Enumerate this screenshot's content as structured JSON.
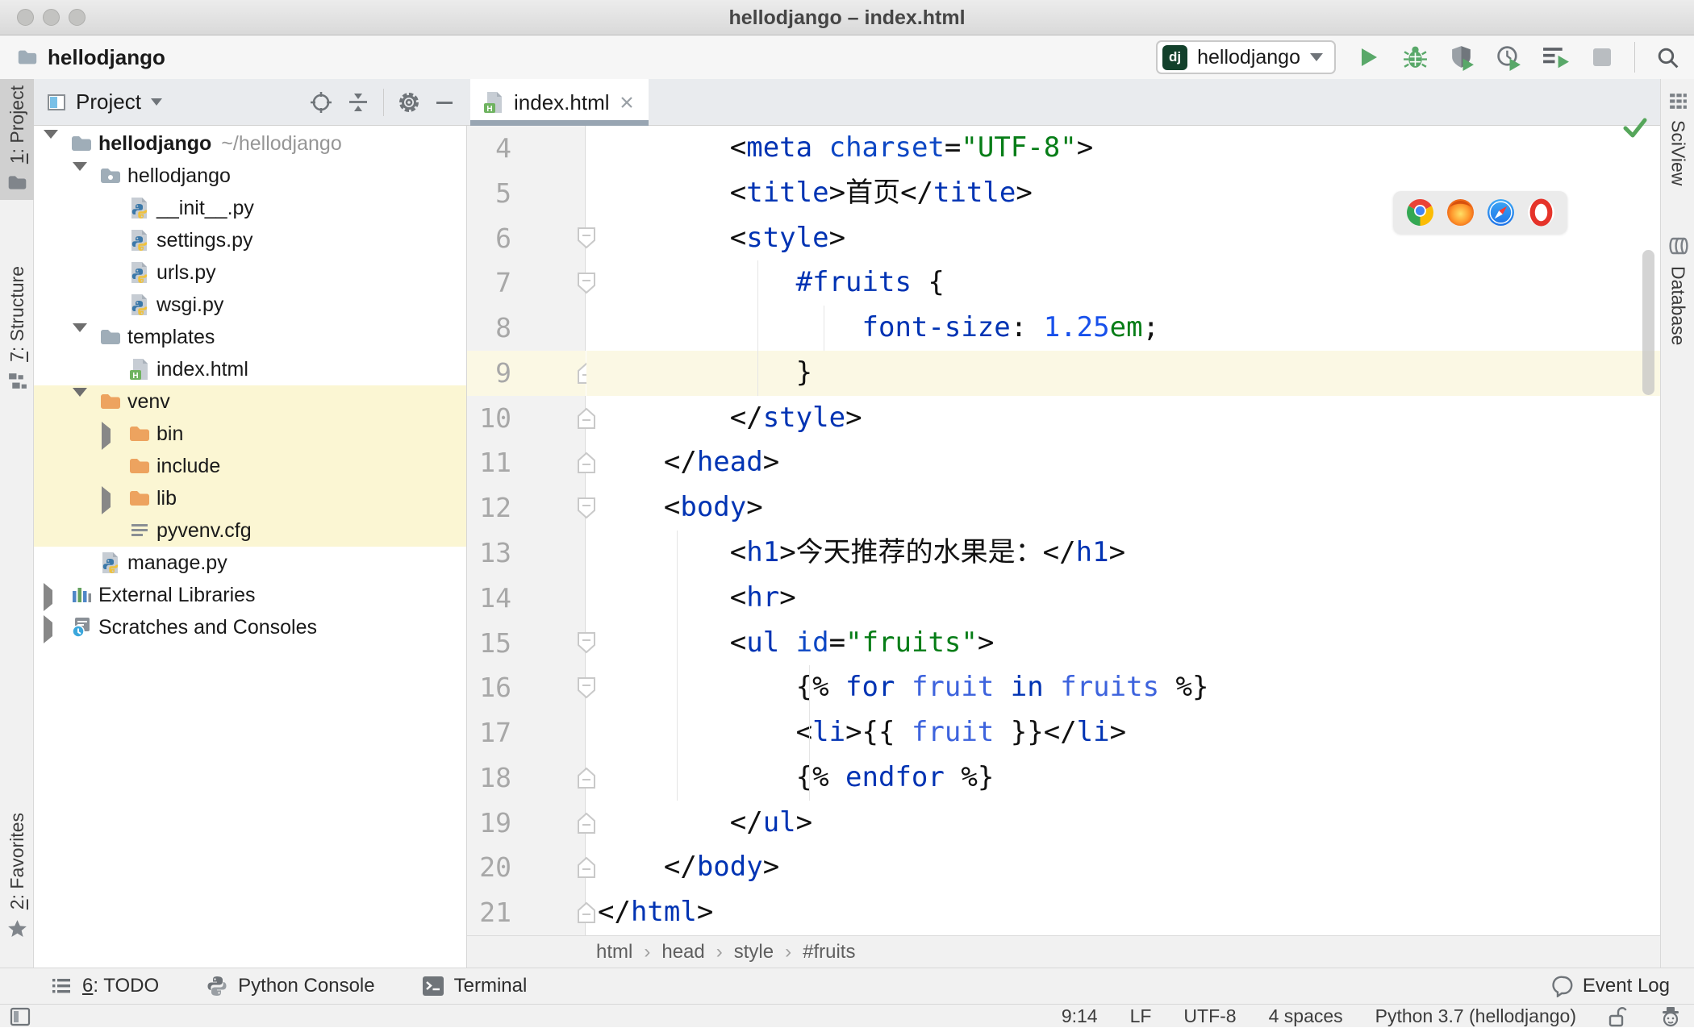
{
  "window": {
    "title": "hellodjango – index.html"
  },
  "navbar": {
    "path": "hellodjango",
    "run_badge": "dj",
    "run_config": "hellodjango"
  },
  "left_strip": {
    "items": [
      {
        "mn": "1",
        "rest": ": Project"
      },
      {
        "mn": "7",
        "rest": ": Structure"
      },
      {
        "mn": "2",
        "rest": ": Favorites"
      }
    ]
  },
  "right_strip": {
    "items": [
      "SciView",
      "Database"
    ]
  },
  "project_panel": {
    "title": "Project",
    "tree": [
      {
        "label": "hellodjango",
        "suffix": "~/hellodjango",
        "level": 0,
        "arrow": "down",
        "icon": "folder",
        "bold": true,
        "hl": false
      },
      {
        "label": "hellodjango",
        "level": 1,
        "arrow": "down",
        "icon": "folder-pkg",
        "hl": false
      },
      {
        "label": "__init__.py",
        "level": 2,
        "arrow": null,
        "icon": "py",
        "hl": false
      },
      {
        "label": "settings.py",
        "level": 2,
        "arrow": null,
        "icon": "py",
        "hl": false
      },
      {
        "label": "urls.py",
        "level": 2,
        "arrow": null,
        "icon": "py",
        "hl": false
      },
      {
        "label": "wsgi.py",
        "level": 2,
        "arrow": null,
        "icon": "py",
        "hl": false
      },
      {
        "label": "templates",
        "level": 1,
        "arrow": "down",
        "icon": "folder",
        "hl": false
      },
      {
        "label": "index.html",
        "level": 2,
        "arrow": null,
        "icon": "html",
        "hl": false
      },
      {
        "label": "venv",
        "level": 1,
        "arrow": "down",
        "icon": "folder-ex",
        "hl": true
      },
      {
        "label": "bin",
        "level": 2,
        "arrow": "right",
        "icon": "folder-ex",
        "hl": true
      },
      {
        "label": "include",
        "level": 2,
        "arrow": null,
        "icon": "folder-ex",
        "hl": true
      },
      {
        "label": "lib",
        "level": 2,
        "arrow": "right",
        "icon": "folder-ex",
        "hl": true
      },
      {
        "label": "pyvenv.cfg",
        "level": 2,
        "arrow": null,
        "icon": "cfg",
        "hl": true
      },
      {
        "label": "manage.py",
        "level": 1,
        "arrow": null,
        "icon": "py",
        "hl": false
      },
      {
        "label": "External Libraries",
        "level": 0,
        "arrow": "right",
        "icon": "extlib",
        "hl": false
      },
      {
        "label": "Scratches and Consoles",
        "level": 0,
        "arrow": "right",
        "icon": "scratch",
        "hl": false
      }
    ]
  },
  "editor": {
    "tab": "index.html",
    "breadcrumbs": [
      "html",
      "head",
      "style",
      "#fruits"
    ],
    "lines": [
      {
        "n": 4,
        "fold": null,
        "caret": false,
        "tokens": [
          [
            "b",
            "        <"
          ],
          [
            "t",
            "meta"
          ],
          [
            "b",
            " "
          ],
          [
            "a",
            "charset"
          ],
          [
            "b",
            "="
          ],
          [
            "s",
            "\"UTF-8\""
          ],
          [
            "b",
            ">"
          ]
        ]
      },
      {
        "n": 5,
        "fold": null,
        "caret": false,
        "tokens": [
          [
            "b",
            "        <"
          ],
          [
            "t",
            "title"
          ],
          [
            "b",
            ">首页</"
          ],
          [
            "t",
            "title"
          ],
          [
            "b",
            ">"
          ]
        ]
      },
      {
        "n": 6,
        "fold": "d",
        "caret": false,
        "tokens": [
          [
            "b",
            "        <"
          ],
          [
            "t",
            "style"
          ],
          [
            "b",
            ">"
          ]
        ]
      },
      {
        "n": 7,
        "fold": "d",
        "caret": false,
        "tokens": [
          [
            "b",
            "            "
          ],
          [
            "k",
            "#fruits"
          ],
          [
            "b",
            " {"
          ]
        ]
      },
      {
        "n": 8,
        "fold": null,
        "caret": false,
        "tokens": [
          [
            "b",
            "                "
          ],
          [
            "t",
            "font-size"
          ],
          [
            "b",
            ": "
          ],
          [
            "n",
            "1.25"
          ],
          [
            "g",
            "em"
          ],
          [
            "b",
            ";"
          ]
        ]
      },
      {
        "n": 9,
        "fold": "u",
        "caret": true,
        "tokens": [
          [
            "b",
            "            }"
          ]
        ]
      },
      {
        "n": 10,
        "fold": "u",
        "caret": false,
        "tokens": [
          [
            "b",
            "        </"
          ],
          [
            "t",
            "style"
          ],
          [
            "b",
            ">"
          ]
        ]
      },
      {
        "n": 11,
        "fold": "u",
        "caret": false,
        "tokens": [
          [
            "b",
            "    </"
          ],
          [
            "t",
            "head"
          ],
          [
            "b",
            ">"
          ]
        ]
      },
      {
        "n": 12,
        "fold": "d",
        "caret": false,
        "tokens": [
          [
            "b",
            "    <"
          ],
          [
            "t",
            "body"
          ],
          [
            "b",
            ">"
          ]
        ]
      },
      {
        "n": 13,
        "fold": null,
        "caret": false,
        "tokens": [
          [
            "b",
            "        <"
          ],
          [
            "t",
            "h1"
          ],
          [
            "b",
            ">今天推荐的水果是：</"
          ],
          [
            "t",
            "h1"
          ],
          [
            "b",
            ">"
          ]
        ]
      },
      {
        "n": 14,
        "fold": null,
        "caret": false,
        "tokens": [
          [
            "b",
            "        <"
          ],
          [
            "t",
            "hr"
          ],
          [
            "b",
            ">"
          ]
        ]
      },
      {
        "n": 15,
        "fold": "d",
        "caret": false,
        "tokens": [
          [
            "b",
            "        <"
          ],
          [
            "t",
            "ul"
          ],
          [
            "b",
            " "
          ],
          [
            "a",
            "id"
          ],
          [
            "b",
            "="
          ],
          [
            "s",
            "\"fruits\""
          ],
          [
            "b",
            ">"
          ]
        ]
      },
      {
        "n": 16,
        "fold": "d",
        "caret": false,
        "tokens": [
          [
            "b",
            "            {% "
          ],
          [
            "k",
            "for"
          ],
          [
            "b",
            " "
          ],
          [
            "v",
            "fruit"
          ],
          [
            "b",
            " "
          ],
          [
            "k",
            "in"
          ],
          [
            "b",
            " "
          ],
          [
            "v",
            "fruits"
          ],
          [
            "b",
            " %}"
          ]
        ]
      },
      {
        "n": 17,
        "fold": null,
        "caret": false,
        "tokens": [
          [
            "b",
            "            <"
          ],
          [
            "t",
            "li"
          ],
          [
            "b",
            ">{{ "
          ],
          [
            "v",
            "fruit"
          ],
          [
            "b",
            " }}</"
          ],
          [
            "t",
            "li"
          ],
          [
            "b",
            ">"
          ]
        ]
      },
      {
        "n": 18,
        "fold": "u",
        "caret": false,
        "tokens": [
          [
            "b",
            "            {% "
          ],
          [
            "k",
            "endfor"
          ],
          [
            "b",
            " %}"
          ]
        ]
      },
      {
        "n": 19,
        "fold": "u",
        "caret": false,
        "tokens": [
          [
            "b",
            "        </"
          ],
          [
            "t",
            "ul"
          ],
          [
            "b",
            ">"
          ]
        ]
      },
      {
        "n": 20,
        "fold": "u",
        "caret": false,
        "tokens": [
          [
            "b",
            "    </"
          ],
          [
            "t",
            "body"
          ],
          [
            "b",
            ">"
          ]
        ]
      },
      {
        "n": 21,
        "fold": "u",
        "caret": false,
        "tokens": [
          [
            "b",
            "</"
          ],
          [
            "t",
            "html"
          ],
          [
            "b",
            ">"
          ]
        ]
      }
    ]
  },
  "bottom_bar": {
    "items": [
      {
        "mn": "6",
        "rest": ": TODO",
        "icon": "todo-list-icon"
      },
      {
        "mn": "",
        "rest": "Python Console",
        "icon": "python-icon"
      },
      {
        "mn": "",
        "rest": "Terminal",
        "icon": "terminal-icon"
      }
    ],
    "right_label": "Event Log"
  },
  "status_bar": {
    "items": [
      "9:14",
      "LF",
      "UTF-8",
      "4 spaces",
      "Python 3.7 (hellodjango)"
    ]
  },
  "icons": {
    "toolbar": [
      "run-icon",
      "debug-icon",
      "run-with-coverage-icon",
      "profiler-icon",
      "run-concurrency-icon",
      "stop-icon",
      "search-icon"
    ],
    "browser_popup": [
      "chrome-icon",
      "firefox-icon",
      "safari-icon",
      "opera-icon"
    ],
    "panel_header": [
      "locate-icon",
      "collapse-all-icon",
      "settings-gear-icon",
      "hide-panel-icon"
    ]
  },
  "colors": {
    "tag_blue": "#0033b3",
    "string_green": "#067d17",
    "variable_blue": "#3d63dd",
    "run_green": "#59a869",
    "excluded_yellow": "#fbf6d3",
    "caret_line": "#fbf8e4",
    "tab_underline": "#98a5b2",
    "dj_badge_bg": "#12402b",
    "check_green": "#55a65a"
  }
}
